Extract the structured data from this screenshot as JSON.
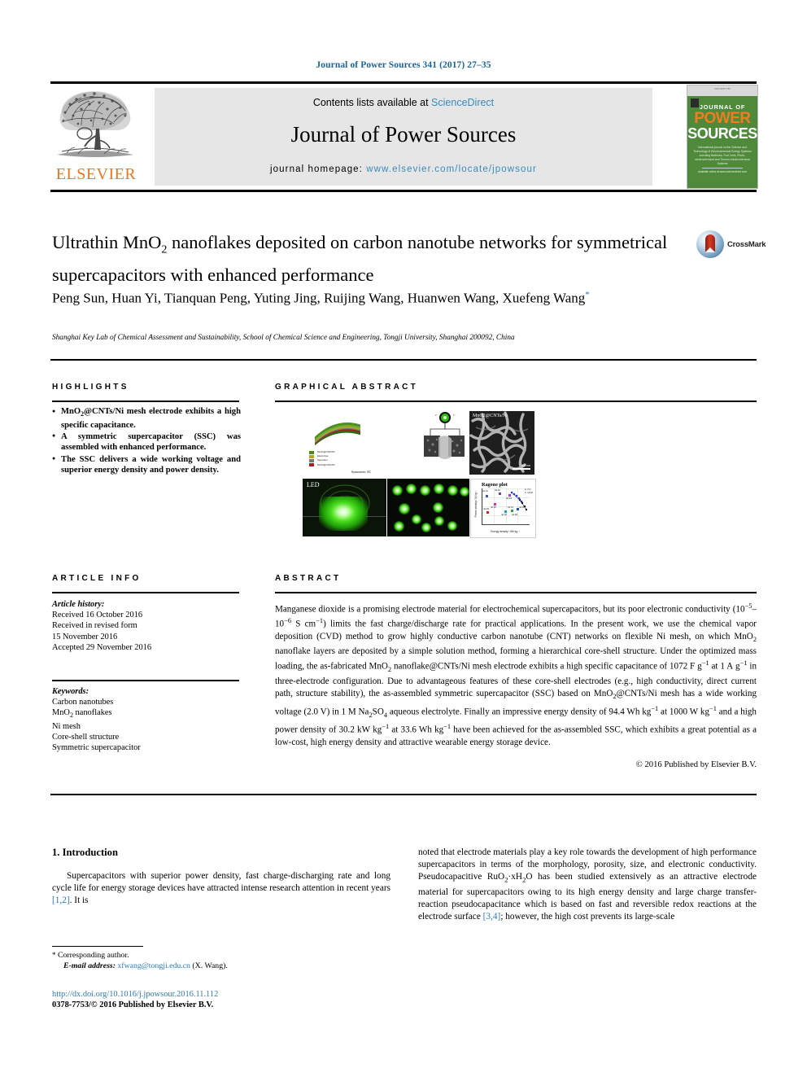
{
  "running_head": "Journal of Power Sources 341 (2017) 27–35",
  "masthead": {
    "contents_prefix": "Contents lists available at ",
    "contents_link": "ScienceDirect",
    "journal_name": "Journal of Power Sources",
    "homepage_prefix": "journal homepage: ",
    "homepage_url": "www.elsevier.com/locate/jpowsour",
    "publisher_logo_text": "ELSEVIER",
    "cover": {
      "top_tiny": "ISSN 0378-7753",
      "journal_word": "JOURNAL OF",
      "power_word": "POWER",
      "sources_word": "SOURCES",
      "subtitle": "International journal on the Science and Technology of Electrochemical Energy Systems including Batteries, Fuel Cells, Photo-electrochemical and Thermo-electrochemical Systems",
      "footer": "Available online at www.sciencedirect.com"
    }
  },
  "article": {
    "title_line1_a": "Ultrathin MnO",
    "title_line1_sub": "2",
    "title_line1_b": " nanoflakes deposited on carbon nanotube networks",
    "title_line2": "for symmetrical supercapacitors with enhanced performance",
    "authors": "Peng Sun, Huan Yi, Tianquan Peng, Yuting Jing, Ruijing Wang, Huanwen Wang, Xuefeng Wang",
    "corresponding_marker": "*",
    "affiliation": "Shanghai Key Lab of Chemical Assessment and Sustainability, School of Chemical Science and Engineering, Tongji University, Shanghai 200092, China",
    "crossmark_label": "CrossMark"
  },
  "sections": {
    "highlights_heading": "HIGHLIGHTS",
    "graphical_abstract_heading": "GRAPHICAL ABSTRACT",
    "article_info_heading": "ARTICLE INFO",
    "abstract_heading": "ABSTRACT"
  },
  "highlights": [
    {
      "pre": "MnO",
      "sub": "2",
      "post": "@CNTs/Ni mesh electrode exhibits a high specific capacitance."
    },
    {
      "pre": "A symmetric supercapacitor (SSC) was assembled with enhanced performance.",
      "sub": "",
      "post": ""
    },
    {
      "pre": "The SSC delivers a wide working voltage and superior energy density and power density.",
      "sub": "",
      "post": ""
    }
  ],
  "article_info": {
    "history_label": "Article history:",
    "history_lines": [
      "Received 16 October 2016",
      "Received in revised form",
      "15 November 2016",
      "Accepted 29 November 2016"
    ],
    "keywords_label": "Keywords:",
    "keywords": [
      {
        "pre": "Carbon nanotubes",
        "sub": "",
        "post": ""
      },
      {
        "pre": "MnO",
        "sub": "2",
        "post": " nanoflakes"
      },
      {
        "pre": "Ni mesh",
        "sub": "",
        "post": ""
      },
      {
        "pre": "Core-shell structure",
        "sub": "",
        "post": ""
      },
      {
        "pre": "Symmetric supercapacitor",
        "sub": "",
        "post": ""
      }
    ]
  },
  "abstract": {
    "copyright": "© 2016 Published by Elsevier B.V."
  },
  "graphical_abstract": {
    "legend": [
      {
        "label": "MnO2@CNTs/Ni",
        "color": "#3f8f1f"
      },
      {
        "label": "Electrolyte",
        "color": "#b7a31c"
      },
      {
        "label": "Separator",
        "color": "#777777"
      },
      {
        "label": "MnO2@CNTs/Ni",
        "color": "#a81f1f"
      }
    ],
    "stack_caption": "Symmetric SC",
    "sem_label": "MnO2@CNTs/Ni",
    "sem_scalebar": "500 nm",
    "led_label": "LED",
    "plot": {
      "title": "Ragone plot",
      "xlabel": "Energy density / Wh kg⁻¹",
      "ylabel": "Power density / W kg⁻¹",
      "legend": [
        "a. CV",
        "b. GCD"
      ],
      "point_labels": [
        "ref.12",
        "ref.16",
        "ref.24",
        "ref.23",
        "ref.29",
        "ref.30",
        "ref.31",
        "ref.28",
        "ref.38"
      ]
    }
  },
  "body": {
    "intro_heading": "1.  Introduction",
    "col_left_para": "Supercapacitors with superior power density, fast charge-discharging rate and long cycle life for energy storage devices have attracted intense research attention in recent years [1,2]. It is",
    "col_left_ref": "[1,2]",
    "col_right_para_1": "noted that electrode materials play a key role towards the development of high performance supercapacitors in terms of the morphology, porosity, size, and electronic conductivity. Pseudocapacitive RuO",
    "col_right_para_2": "·xH",
    "col_right_para_3": "O has been studied extensively as an attractive electrode material for supercapacitors owing to its high energy density and large charge transfer-reaction pseudocapacitance which is based on fast and reversible redox reactions at the electrode surface ",
    "col_right_ref": "[3,4]",
    "col_right_para_4": "; however, the high cost prevents its large-scale"
  },
  "footer": {
    "corresponding_star": "*",
    "corresponding_text": "Corresponding author.",
    "email_label": "E-mail address:",
    "email": "xfwang@tongji.edu.cn",
    "email_suffix": "(X. Wang).",
    "doi": "http://dx.doi.org/10.1016/j.jpowsour.2016.11.112",
    "issn": "0378-7753/© 2016 Published by Elsevier B.V."
  },
  "colors": {
    "link": "#2b7bb9",
    "elsevier_orange": "#E87722",
    "cover_green": "#4e8a3a",
    "band_gray": "#e6e6e6"
  }
}
